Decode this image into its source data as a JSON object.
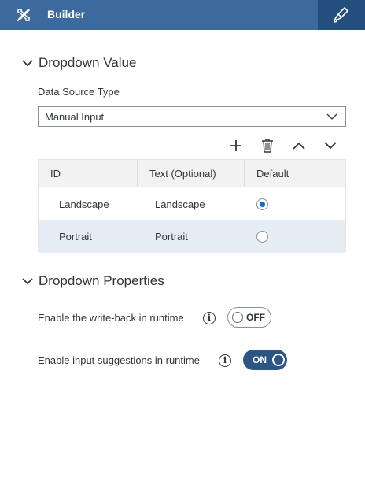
{
  "header": {
    "title": "Builder",
    "left_icon": "tools-icon",
    "right_icon": "paint-brush-icon",
    "bg_color": "#3d6a9e",
    "right_bg_color": "#234e7d"
  },
  "dropdown_value": {
    "section_title": "Dropdown Value",
    "data_source_label": "Data Source Type",
    "data_source_value": "Manual Input",
    "toolbar": [
      "add-icon",
      "delete-icon",
      "move-up-icon",
      "move-down-icon"
    ],
    "table": {
      "headers": [
        "ID",
        "Text (Optional)",
        "Default"
      ],
      "rows": [
        {
          "id": "Landscape",
          "text": "Landscape",
          "default": true
        },
        {
          "id": "Portrait",
          "text": "Portrait",
          "default": false
        }
      ]
    }
  },
  "dropdown_properties": {
    "section_title": "Dropdown Properties",
    "writeback_label": "Enable the write-back in runtime",
    "writeback_state": "OFF",
    "suggestions_label": "Enable input suggestions in runtime",
    "suggestions_state": "ON"
  },
  "colors": {
    "accent": "#0a6ed1",
    "switch_on": "#2b5582",
    "selected_row": "#e5ecf3"
  }
}
